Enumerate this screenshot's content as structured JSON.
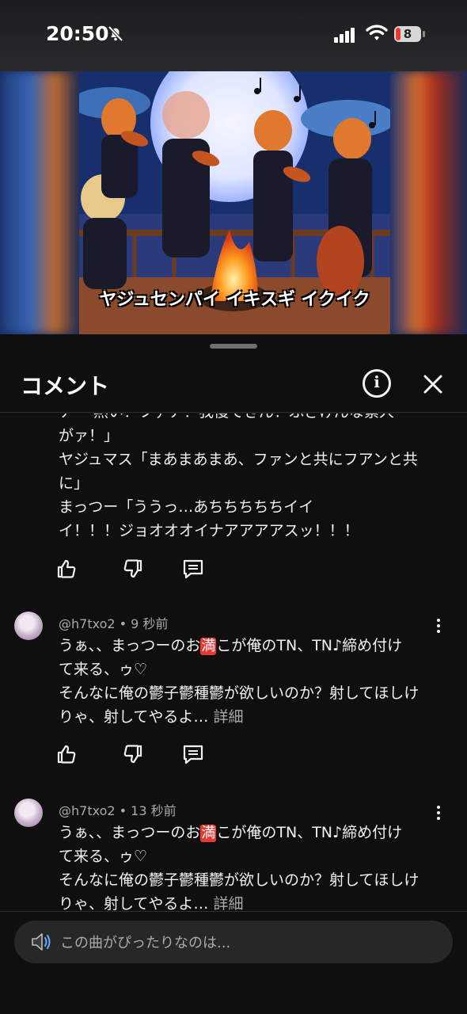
{
  "status_bar": {
    "time": "20:50",
    "battery_level": "8",
    "battery_color": "#e53935"
  },
  "video": {
    "caption": "ヤジュセンパイ イキスギ イクイク"
  },
  "sheet": {
    "title": "コメント",
    "icons": {
      "info": "info-icon",
      "close": "close-icon",
      "like": "thumbs-up-icon",
      "dislike": "thumbs-down-icon",
      "reply": "reply-icon",
      "more": "more-vert-icon",
      "composer": "speaker-icon"
    }
  },
  "comments": {
    "partial": {
      "line_top_cut": "ナー 熱い！ファア！我慢できん！ふざけんな素人",
      "lines": "がァ！」\nヤジュマス「まあまあまあ、ファンと共にフアンと共\nに」\nまっつー「ううっ…あちちちちちイイ\nイ！！！ジョオオオイナアアアアスッ！！！"
    },
    "items": [
      {
        "author": "@h7txo2",
        "time": "9 秒前",
        "line1_pre": "うぁ、、まっつーのお",
        "badge": "満",
        "line1_post": "こが俺のTN、TN♪締め付け",
        "rest": "て来る、ゥ♡\nそんなに俺の鬱子鬱種鬱が欲しいのか？射してほしけ\nりゃ、射してやるよ… ",
        "more": "詳細"
      },
      {
        "author": "@h7txo2",
        "time": "13 秒前",
        "line1_pre": "うぁ、、まっつーのお",
        "badge": "満",
        "line1_post": "こが俺のTN、TN♪締め付け",
        "rest": "て来る、ゥ♡\nそんなに俺の鬱子鬱種鬱が欲しいのか？射してほしけ\nりゃ、射してやるよ… ",
        "more": "詳細"
      }
    ]
  },
  "composer": {
    "placeholder": "この曲がぴったりなのは..."
  }
}
